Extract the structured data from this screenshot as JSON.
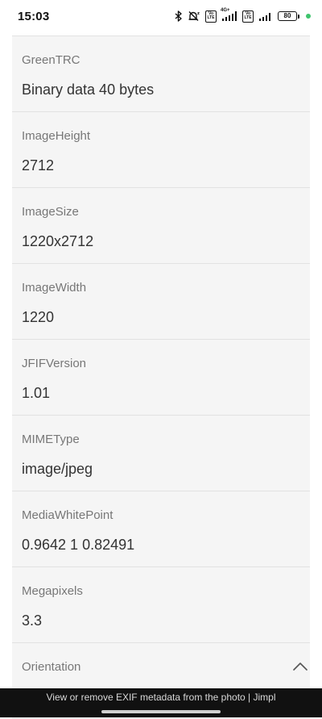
{
  "status_bar": {
    "time": "15:03",
    "network_label": "4G+",
    "volte_label_top": "Vo",
    "volte_label_bottom": "LTE",
    "battery_level": "80",
    "icons": [
      "bluetooth-icon",
      "silent-icon",
      "volte-icon",
      "signal-icon",
      "volte-icon",
      "signal-icon",
      "battery-icon"
    ]
  },
  "metadata": [
    {
      "label": "GreenTRC",
      "value": "Binary data 40 bytes"
    },
    {
      "label": "ImageHeight",
      "value": "2712"
    },
    {
      "label": "ImageSize",
      "value": "1220x2712"
    },
    {
      "label": "ImageWidth",
      "value": "1220"
    },
    {
      "label": "JFIFVersion",
      "value": "1.01"
    },
    {
      "label": "MIMEType",
      "value": "image/jpeg"
    },
    {
      "label": "MediaWhitePoint",
      "value": "0.9642 1 0.82491"
    },
    {
      "label": "Megapixels",
      "value": "3.3"
    },
    {
      "label": "Orientation",
      "value": ""
    }
  ],
  "scroll_top": {
    "icon": "chevron-up-icon"
  },
  "bottom_bar": {
    "page_title": "View or remove EXIF metadata from the photo | Jimpl"
  },
  "colors": {
    "row_background": "#f5f5f5",
    "label": "#777777",
    "value": "#333333",
    "bottom_bar": "#111111",
    "status_dot": "#3ec46d"
  }
}
